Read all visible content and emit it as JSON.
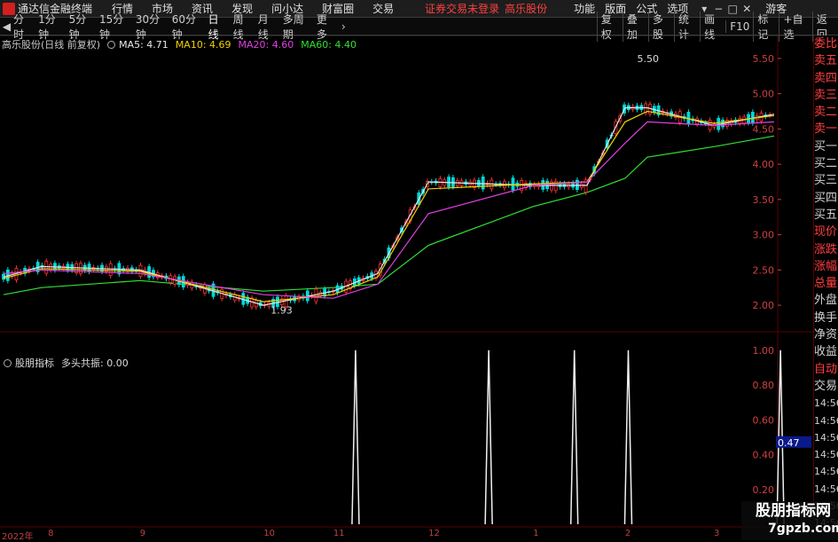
{
  "titlebar": {
    "app_title": "通达信金融终端",
    "menu": [
      "行情",
      "市场",
      "资讯",
      "发现",
      "问小达",
      "财富圈",
      "交易"
    ],
    "status": "证券交易未登录",
    "stock_name": "高乐股份",
    "right_menu": [
      "功能",
      "版面",
      "公式",
      "选项"
    ],
    "window_buttons": [
      "▾",
      "−",
      "□",
      "✕"
    ],
    "guest": "游客"
  },
  "toolbar": {
    "periods": [
      "分时",
      "1分钟",
      "5分钟",
      "15分钟",
      "30分钟",
      "60分钟",
      "日线",
      "周线",
      "月线",
      "多周期",
      "更多"
    ],
    "active_period": "日线",
    "buttons": [
      "复权",
      "叠加",
      "多股",
      "统计",
      "画线",
      "F10",
      "标记",
      "+自选",
      "返回"
    ]
  },
  "chart_head": {
    "title": "高乐股份(日线 前复权)",
    "ma": [
      {
        "label": "MA5: 4.71",
        "color": "#e8e8e8"
      },
      {
        "label": "MA10: 4.69",
        "color": "#f0d000"
      },
      {
        "label": "MA20: 4.60",
        "color": "#e040e0"
      },
      {
        "label": "MA60: 4.40",
        "color": "#30e030"
      }
    ]
  },
  "indicator_head": {
    "title": "股朋指标",
    "value_label": "多头共振: 0.00"
  },
  "price_axis": [
    "5.50",
    "5.00",
    "4.50",
    "4.00",
    "3.50",
    "3.00",
    "2.50",
    "2.00"
  ],
  "indicator_axis": [
    "1.00",
    "0.80",
    "0.60",
    "0.40",
    "0.20"
  ],
  "indicator_marker": "0.47",
  "annotations": {
    "high": "5.50",
    "low": "1.93"
  },
  "right_panel": {
    "labels": [
      "委比",
      "卖五",
      "卖四",
      "卖三",
      "卖二",
      "卖一",
      "买一",
      "买二",
      "买三",
      "买四",
      "买五",
      "现价",
      "涨跌",
      "涨幅",
      "总量",
      "外盘",
      "换手",
      "净资",
      "收益",
      "自动",
      "交易"
    ],
    "times": [
      "14:56",
      "14:56",
      "14:56",
      "14:56",
      "14:56",
      "14:56",
      "14:56",
      "14:56"
    ]
  },
  "date_axis": [
    "2022年",
    "8",
    "9",
    "10",
    "11",
    "12",
    "1",
    "2",
    "3"
  ],
  "watermark": {
    "main": "股朋指标网",
    "sub": "7gpzb.com"
  },
  "colors": {
    "up": "#ff3030",
    "down": "#00d8d8",
    "ma5": "#e8e8e8",
    "ma10": "#f0d000",
    "ma20": "#e040e0",
    "ma60": "#30e030",
    "grid": "#5a0000"
  },
  "chart_data": {
    "type": "line",
    "x": [
      "2022-07-20",
      "2022-08-01",
      "2022-09-01",
      "2022-10-10",
      "2022-11-01",
      "2022-11-15",
      "2022-12-01",
      "2023-01-03",
      "2023-01-20",
      "2023-02-01",
      "2023-02-08",
      "2023-03-01",
      "2023-03-20"
    ],
    "series": [
      {
        "name": "MA5",
        "values": [
          2.4,
          2.55,
          2.5,
          2.0,
          2.2,
          2.45,
          3.75,
          3.7,
          3.7,
          4.8,
          4.8,
          4.55,
          4.71
        ]
      },
      {
        "name": "MA10",
        "values": [
          2.38,
          2.52,
          2.48,
          2.05,
          2.15,
          2.4,
          3.65,
          3.72,
          3.75,
          4.6,
          4.75,
          4.58,
          4.69
        ]
      },
      {
        "name": "MA20",
        "values": [
          2.45,
          2.5,
          2.45,
          2.15,
          2.1,
          2.3,
          3.3,
          3.7,
          3.75,
          4.3,
          4.6,
          4.55,
          4.6
        ]
      },
      {
        "name": "MA60",
        "values": [
          2.15,
          2.25,
          2.35,
          2.2,
          2.25,
          2.3,
          2.85,
          3.4,
          3.6,
          3.8,
          4.1,
          4.25,
          4.4
        ]
      }
    ],
    "ylim": [
      1.8,
      5.7
    ],
    "indicator": {
      "name": "多头共振",
      "spike_dates": [
        "2022-11-08",
        "2022-12-20",
        "2023-01-16",
        "2023-02-02",
        "2023-03-22"
      ],
      "spike_values": [
        1.0,
        1.0,
        1.0,
        1.0,
        1.0
      ],
      "ylim": [
        0,
        1.05
      ]
    }
  }
}
